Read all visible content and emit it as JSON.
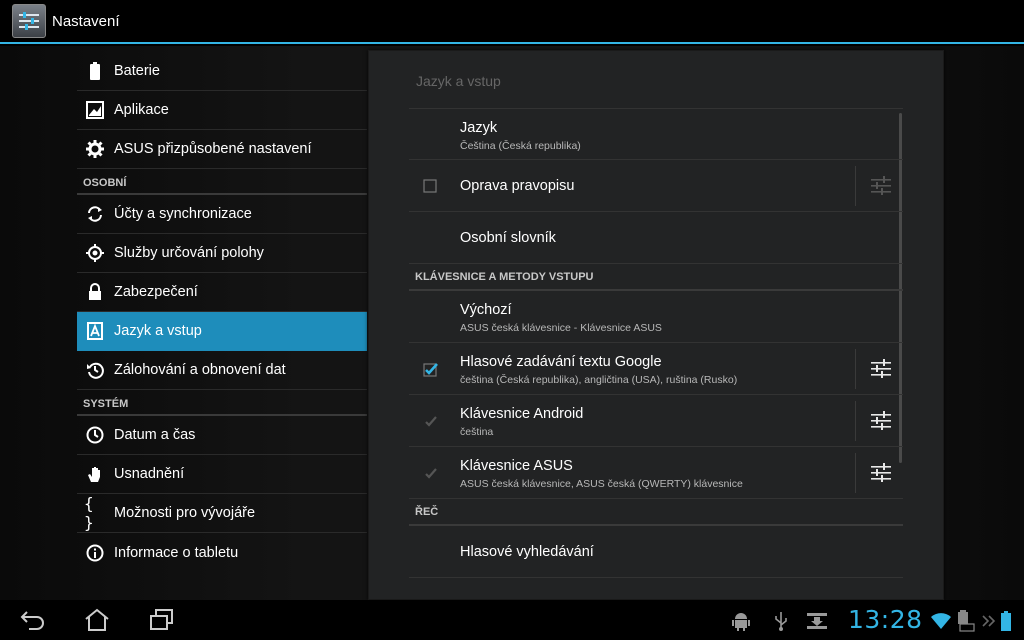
{
  "app": {
    "title": "Nastavení",
    "icon": "settings-sliders-icon"
  },
  "sidebar": {
    "top_items": [
      {
        "label": "Baterie",
        "icon": "battery-icon"
      },
      {
        "label": "Aplikace",
        "icon": "apps-icon"
      },
      {
        "label": "ASUS přizpůsobené nastavení",
        "icon": "gear-icon"
      }
    ],
    "section_personal": "OSOBNÍ",
    "personal_items": [
      {
        "label": "Účty a synchronizace",
        "icon": "sync-icon"
      },
      {
        "label": "Služby určování polohy",
        "icon": "location-icon"
      },
      {
        "label": "Zabezpečení",
        "icon": "lock-icon"
      },
      {
        "label": "Jazyk a vstup",
        "icon": "language-icon",
        "selected": true
      },
      {
        "label": "Zálohování a obnovení dat",
        "icon": "backup-icon"
      }
    ],
    "section_system": "SYSTÉM",
    "system_items": [
      {
        "label": "Datum a čas",
        "icon": "clock-icon"
      },
      {
        "label": "Usnadnění",
        "icon": "hand-icon"
      },
      {
        "label": "Možnosti pro vývojáře",
        "icon": "braces-icon"
      },
      {
        "label": "Informace o tabletu",
        "icon": "info-icon"
      }
    ]
  },
  "panel": {
    "title": "Jazyk a vstup",
    "language": {
      "title": "Jazyk",
      "summary": "Čeština (Česká republika)"
    },
    "spellcheck": {
      "title": "Oprava pravopisu",
      "checked": false
    },
    "dictionary": {
      "title": "Osobní slovník"
    },
    "section_keyboards": "KLÁVESNICE A METODY VSTUPU",
    "default": {
      "title": "Výchozí",
      "summary": "ASUS česká klávesnice - Klávesnice ASUS"
    },
    "google_voice": {
      "title": "Hlasové zadávání textu Google",
      "summary": "čeština (Česká republika), angličtina (USA), ruština (Rusko)",
      "checked": true
    },
    "android_kb": {
      "title": "Klávesnice Android",
      "summary": "čeština",
      "checked": true,
      "disabled": true
    },
    "asus_kb": {
      "title": "Klávesnice ASUS",
      "summary": "ASUS česká klávesnice, ASUS česká (QWERTY) klávesnice",
      "checked": true,
      "disabled": true
    },
    "section_speech": "ŘEČ",
    "voice_search": {
      "title": "Hlasové vyhledávání"
    }
  },
  "navbar": {
    "clock": "13:28",
    "buttons": [
      "back-icon",
      "home-icon",
      "recent-apps-icon"
    ],
    "status_icons": [
      "android-debug-icon",
      "usb-icon",
      "download-icon",
      "wifi-icon",
      "keyboard-battery-icon",
      "battery-icon"
    ]
  },
  "colors": {
    "accent": "#33b5e5",
    "selected": "#1e8dbb"
  }
}
